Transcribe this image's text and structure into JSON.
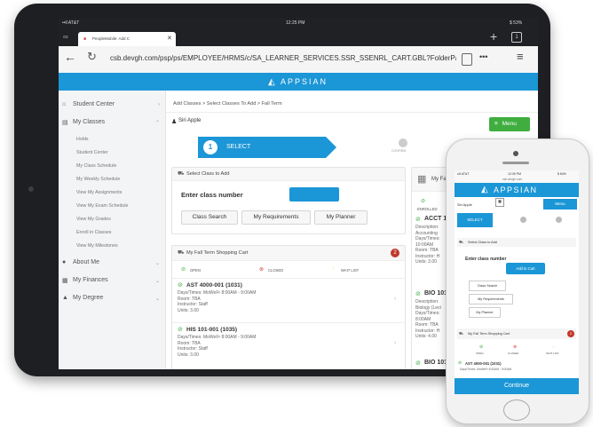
{
  "status": {
    "carrier": "••ll AT&T",
    "time": "12:25 PM",
    "battery": "$ 53%"
  },
  "tab": {
    "label": "PeopleMobile: Add C",
    "close": "✕"
  },
  "browser": {
    "url": "csb.devgh.com/psp/ps/EMPLOYEE/HRMS/c/SA_LEARNER_SERVICES.SSR_SSENRL_CART.GBL?FolderPath=...",
    "tabs_count": "1",
    "more": "•••"
  },
  "brand": {
    "name": "APPSIAN"
  },
  "sidebar": {
    "items": [
      {
        "label": "Student Center"
      },
      {
        "label": "My Classes"
      },
      {
        "label": "About Me"
      },
      {
        "label": "My Finances"
      },
      {
        "label": "My Degree"
      }
    ],
    "sub_items": [
      "Holds",
      "Student Center",
      "My Class Schedule",
      "My Weekly Schedule",
      "View My Assignments",
      "View My Exam Schedule",
      "View My Grades",
      "Enroll in Classes",
      "View My Milestones"
    ]
  },
  "main": {
    "breadcrumb": "Add Classes  >  Select Classes To Add  >  Fall Term",
    "user": "Siri Apple",
    "menu_label": "Menu",
    "steps": {
      "step1_num": "1",
      "step1_label": "SELECT",
      "step2_label": "CONFIRM"
    },
    "select_card": {
      "title": "Select Class to Add",
      "enter_label": "Enter class number",
      "buttons": [
        "Class Search",
        "My Requirements",
        "My Planner"
      ]
    },
    "cart": {
      "title": "My Fall Term Shopping Cart",
      "count": "2",
      "legend": [
        "OPEN",
        "CLOSED",
        "WAIT LIST"
      ],
      "classes": [
        {
          "title": "AST 4000-001 (1031)",
          "days": "Days/Times: MoWeFr 8:00AM - 9:00AM",
          "room": "Room: TBA",
          "instructor": "Instructor: Staff",
          "units": "Units: 3.00"
        },
        {
          "title": "HIS 101-001 (1035)",
          "days": "Days/Times: MoWeFr 8:00AM - 9:00AM",
          "room": "Room: TBA",
          "instructor": "Instructor: Staff",
          "units": "Units: 3.00"
        }
      ]
    },
    "right_panel": {
      "title": "My Fa",
      "enrolled": "ENROLLED",
      "entries": [
        {
          "title": "ACCT 1",
          "lines": [
            "Description:",
            "Accounting",
            "Days/Times:",
            "10:00AM",
            "Room: TBA",
            "Instructor: H",
            "Units: 3.00"
          ]
        },
        {
          "title": "BIO 101",
          "lines": [
            "Description:",
            "Biology (Lect",
            "Days/Times:",
            "8:00AM",
            "Room: TBA",
            "Instructor: H",
            "Units: 4.00"
          ]
        },
        {
          "title": "BIO 101",
          "lines": [
            "Description:"
          ]
        }
      ]
    }
  },
  "phone": {
    "status": {
      "carrier": "••ll AT&T",
      "time": "12:39 PM",
      "battery": "$ 84%"
    },
    "url": "csb.devgh.com",
    "brand": "APPSIAN",
    "user": "Siri Apple",
    "menu_label": "Menu",
    "step_label": "SELECT",
    "select_title": "Select Class to Add",
    "enter_label": "Enter class number",
    "add_button": "Add to Cart",
    "buttons": [
      "Class Search",
      "My Requirements",
      "My Planner"
    ],
    "cart_title": "My Fall Term Shopping Cart",
    "cart_count": "2",
    "legend": [
      "OPEN",
      "CLOSED",
      "WAIT LIST"
    ],
    "class_title": "AST 4000-001 (1031)",
    "class_days": "Days/Times: MoWeFr 8:00AM - 9:00AM",
    "continue": "Continue"
  },
  "colors": {
    "accent": "#1b96d6",
    "open": "#3fae3f",
    "closed": "#d9534f",
    "waitlist": "#f0ad4e",
    "badge": "#c0392b",
    "dark_chrome": "#202124"
  }
}
